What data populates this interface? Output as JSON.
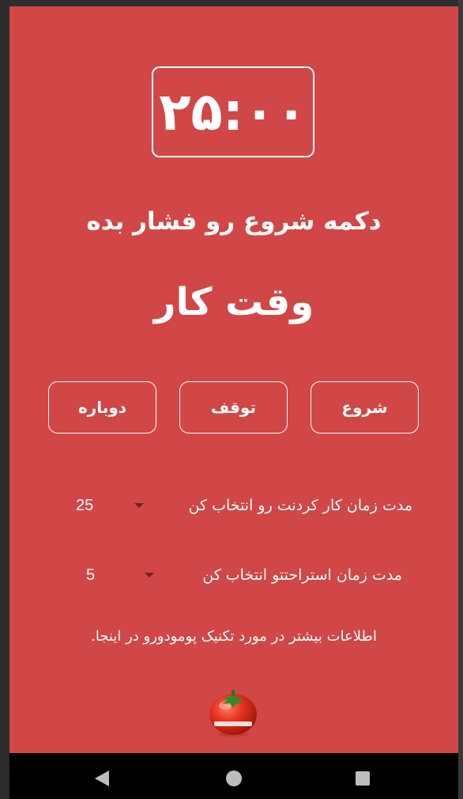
{
  "colors": {
    "background": "#d14646",
    "text": "#ffffff",
    "dropdown_caret": "#7a1f1f",
    "navbar": "#000000",
    "nav_icons": "#bdbdbd"
  },
  "timer": {
    "display": "۲۵:۰۰"
  },
  "instruction": "دکمه شروع رو فشار بده",
  "mode": "وقت کار",
  "buttons": {
    "start": "شروع",
    "stop": "توقف",
    "reset": "دوباره"
  },
  "settings": {
    "work": {
      "label": "مدت زمان کار کردنت رو انتخاب کن",
      "value": "25"
    },
    "rest": {
      "label": "مدت زمان استراحتتو انتخاب کن",
      "value": "5"
    }
  },
  "info_link": "اطلاعات بیشتر در مورد تکنیک پومودورو در اینجا.",
  "icons": {
    "tomato": "tomato-timer-icon",
    "back": "back-icon",
    "home": "home-icon",
    "recents": "recents-icon"
  }
}
